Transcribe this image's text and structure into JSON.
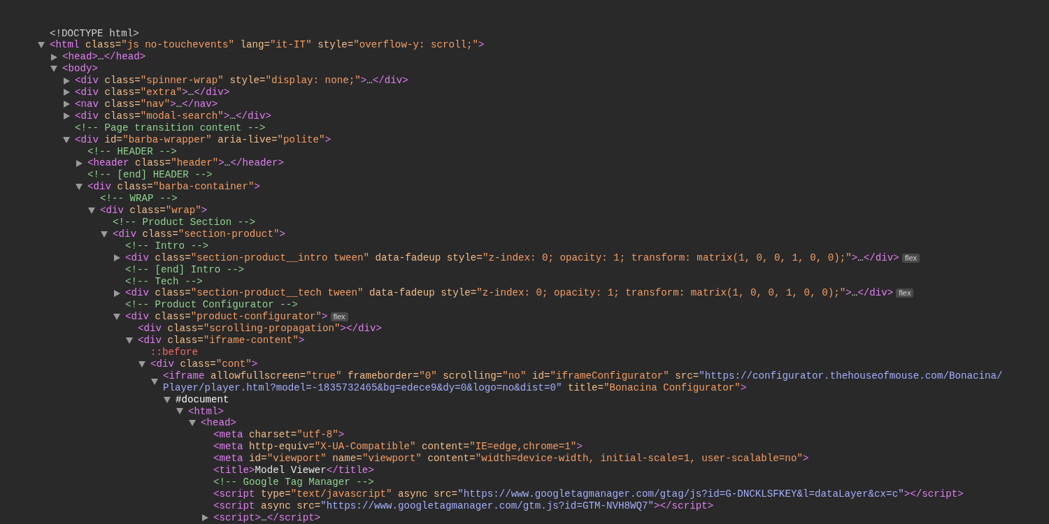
{
  "nodes": [
    {
      "segments": [
        {
          "kind": "doctype",
          "text": "<!DOCTYPE html>"
        }
      ]
    },
    {
      "expanded": true,
      "segments": [
        {
          "kind": "tag",
          "text": "<html"
        },
        {
          "kind": "attr",
          "text": " class="
        },
        {
          "kind": "value",
          "text": "\"js no-touchevents\""
        },
        {
          "kind": "attr",
          "text": " lang="
        },
        {
          "kind": "value",
          "text": "\"it-IT\""
        },
        {
          "kind": "attr",
          "text": " style="
        },
        {
          "kind": "value",
          "text": "\"overflow-y: scroll;\""
        },
        {
          "kind": "tag",
          "text": ">"
        }
      ],
      "children": [
        {
          "expanded": false,
          "segments": [
            {
              "kind": "tag",
              "text": "<head>"
            },
            {
              "kind": "text",
              "text": "…"
            },
            {
              "kind": "tag",
              "text": "</head>"
            }
          ]
        },
        {
          "expanded": true,
          "segments": [
            {
              "kind": "tag",
              "text": "<body>"
            }
          ],
          "children": [
            {
              "expanded": false,
              "segments": [
                {
                  "kind": "tag",
                  "text": "<div"
                },
                {
                  "kind": "attr",
                  "text": " class="
                },
                {
                  "kind": "value",
                  "text": "\"spinner-wrap\""
                },
                {
                  "kind": "attr",
                  "text": " style="
                },
                {
                  "kind": "value",
                  "text": "\"display: none;\""
                },
                {
                  "kind": "tag",
                  "text": ">"
                },
                {
                  "kind": "text",
                  "text": "…"
                },
                {
                  "kind": "tag",
                  "text": "</div>"
                }
              ]
            },
            {
              "expanded": false,
              "segments": [
                {
                  "kind": "tag",
                  "text": "<div"
                },
                {
                  "kind": "attr",
                  "text": " class="
                },
                {
                  "kind": "value",
                  "text": "\"extra\""
                },
                {
                  "kind": "tag",
                  "text": ">"
                },
                {
                  "kind": "text",
                  "text": "…"
                },
                {
                  "kind": "tag",
                  "text": "</div>"
                }
              ]
            },
            {
              "expanded": false,
              "segments": [
                {
                  "kind": "tag",
                  "text": "<nav"
                },
                {
                  "kind": "attr",
                  "text": " class="
                },
                {
                  "kind": "value",
                  "text": "\"nav\""
                },
                {
                  "kind": "tag",
                  "text": ">"
                },
                {
                  "kind": "text",
                  "text": "…"
                },
                {
                  "kind": "tag",
                  "text": "</nav>"
                }
              ]
            },
            {
              "expanded": false,
              "segments": [
                {
                  "kind": "tag",
                  "text": "<div"
                },
                {
                  "kind": "attr",
                  "text": " class="
                },
                {
                  "kind": "value",
                  "text": "\"modal-search\""
                },
                {
                  "kind": "tag",
                  "text": ">"
                },
                {
                  "kind": "text",
                  "text": "…"
                },
                {
                  "kind": "tag",
                  "text": "</div>"
                }
              ]
            },
            {
              "segments": [
                {
                  "kind": "comment",
                  "text": "<!-- Page transition content -->"
                }
              ]
            },
            {
              "expanded": true,
              "segments": [
                {
                  "kind": "tag",
                  "text": "<div"
                },
                {
                  "kind": "attr",
                  "text": " id="
                },
                {
                  "kind": "value",
                  "text": "\"barba-wrapper\""
                },
                {
                  "kind": "attr",
                  "text": " aria-live="
                },
                {
                  "kind": "value",
                  "text": "\"polite\""
                },
                {
                  "kind": "tag",
                  "text": ">"
                }
              ],
              "children": [
                {
                  "segments": [
                    {
                      "kind": "comment",
                      "text": "<!-- HEADER -->"
                    }
                  ]
                },
                {
                  "expanded": false,
                  "segments": [
                    {
                      "kind": "tag",
                      "text": "<header"
                    },
                    {
                      "kind": "attr",
                      "text": " class="
                    },
                    {
                      "kind": "value",
                      "text": "\"header\""
                    },
                    {
                      "kind": "tag",
                      "text": ">"
                    },
                    {
                      "kind": "text",
                      "text": "…"
                    },
                    {
                      "kind": "tag",
                      "text": "</header>"
                    }
                  ]
                },
                {
                  "segments": [
                    {
                      "kind": "comment",
                      "text": "<!-- [end] HEADER -->"
                    }
                  ]
                },
                {
                  "expanded": true,
                  "segments": [
                    {
                      "kind": "tag",
                      "text": "<div"
                    },
                    {
                      "kind": "attr",
                      "text": " class="
                    },
                    {
                      "kind": "value",
                      "text": "\"barba-container\""
                    },
                    {
                      "kind": "tag",
                      "text": ">"
                    }
                  ],
                  "children": [
                    {
                      "segments": [
                        {
                          "kind": "comment",
                          "text": "<!-- WRAP -->"
                        }
                      ]
                    },
                    {
                      "expanded": true,
                      "segments": [
                        {
                          "kind": "tag",
                          "text": "<div"
                        },
                        {
                          "kind": "attr",
                          "text": " class="
                        },
                        {
                          "kind": "value",
                          "text": "\"wrap\""
                        },
                        {
                          "kind": "tag",
                          "text": ">"
                        }
                      ],
                      "children": [
                        {
                          "segments": [
                            {
                              "kind": "comment",
                              "text": "<!-- Product Section -->"
                            }
                          ]
                        },
                        {
                          "expanded": true,
                          "segments": [
                            {
                              "kind": "tag",
                              "text": "<div"
                            },
                            {
                              "kind": "attr",
                              "text": " class="
                            },
                            {
                              "kind": "value",
                              "text": "\"section-product\""
                            },
                            {
                              "kind": "tag",
                              "text": ">"
                            }
                          ],
                          "children": [
                            {
                              "segments": [
                                {
                                  "kind": "comment",
                                  "text": "<!-- Intro -->"
                                }
                              ]
                            },
                            {
                              "expanded": false,
                              "badge": "flex",
                              "segments": [
                                {
                                  "kind": "tag",
                                  "text": "<div"
                                },
                                {
                                  "kind": "attr",
                                  "text": " class="
                                },
                                {
                                  "kind": "value",
                                  "text": "\"section-product__intro tween\""
                                },
                                {
                                  "kind": "attr",
                                  "text": " data-fadeup"
                                },
                                {
                                  "kind": "attr",
                                  "text": " style="
                                },
                                {
                                  "kind": "value",
                                  "text": "\"z-index: 0; opacity: 1; transform: matrix(1, 0, 0, 1, 0, 0);\""
                                },
                                {
                                  "kind": "tag",
                                  "text": ">"
                                },
                                {
                                  "kind": "text",
                                  "text": "…"
                                },
                                {
                                  "kind": "tag",
                                  "text": "</div>"
                                }
                              ]
                            },
                            {
                              "segments": [
                                {
                                  "kind": "comment",
                                  "text": "<!-- [end] Intro -->"
                                }
                              ]
                            },
                            {
                              "segments": [
                                {
                                  "kind": "comment",
                                  "text": "<!-- Tech -->"
                                }
                              ]
                            },
                            {
                              "expanded": false,
                              "badge": "flex",
                              "segments": [
                                {
                                  "kind": "tag",
                                  "text": "<div"
                                },
                                {
                                  "kind": "attr",
                                  "text": " class="
                                },
                                {
                                  "kind": "value",
                                  "text": "\"section-product__tech tween\""
                                },
                                {
                                  "kind": "attr",
                                  "text": " data-fadeup"
                                },
                                {
                                  "kind": "attr",
                                  "text": " style="
                                },
                                {
                                  "kind": "value",
                                  "text": "\"z-index: 0; opacity: 1; transform: matrix(1, 0, 0, 1, 0, 0);\""
                                },
                                {
                                  "kind": "tag",
                                  "text": ">"
                                },
                                {
                                  "kind": "text",
                                  "text": "…"
                                },
                                {
                                  "kind": "tag",
                                  "text": "</div>"
                                }
                              ]
                            },
                            {
                              "segments": [
                                {
                                  "kind": "comment",
                                  "text": "<!-- Product Configurator -->"
                                }
                              ]
                            },
                            {
                              "expanded": true,
                              "badge": "flex",
                              "segments": [
                                {
                                  "kind": "tag",
                                  "text": "<div"
                                },
                                {
                                  "kind": "attr",
                                  "text": " class="
                                },
                                {
                                  "kind": "value",
                                  "text": "\"product-configurator\""
                                },
                                {
                                  "kind": "tag",
                                  "text": ">"
                                }
                              ],
                              "children": [
                                {
                                  "segments": [
                                    {
                                      "kind": "tag",
                                      "text": "<div"
                                    },
                                    {
                                      "kind": "attr",
                                      "text": " class="
                                    },
                                    {
                                      "kind": "value",
                                      "text": "\"scrolling-propagation\""
                                    },
                                    {
                                      "kind": "tag",
                                      "text": "></div>"
                                    }
                                  ]
                                },
                                {
                                  "expanded": true,
                                  "segments": [
                                    {
                                      "kind": "tag",
                                      "text": "<div"
                                    },
                                    {
                                      "kind": "attr",
                                      "text": " class="
                                    },
                                    {
                                      "kind": "value",
                                      "text": "\"iframe-content\""
                                    },
                                    {
                                      "kind": "tag",
                                      "text": ">"
                                    }
                                  ],
                                  "children": [
                                    {
                                      "segments": [
                                        {
                                          "kind": "pseudo",
                                          "text": "::before"
                                        }
                                      ]
                                    },
                                    {
                                      "expanded": true,
                                      "segments": [
                                        {
                                          "kind": "tag",
                                          "text": "<div"
                                        },
                                        {
                                          "kind": "attr",
                                          "text": " class="
                                        },
                                        {
                                          "kind": "value",
                                          "text": "\"cont\""
                                        },
                                        {
                                          "kind": "tag",
                                          "text": ">"
                                        }
                                      ],
                                      "children": [
                                        {
                                          "expanded": true,
                                          "segments": [
                                            {
                                              "kind": "tag",
                                              "text": "<iframe"
                                            },
                                            {
                                              "kind": "attr",
                                              "text": " allowfullscreen="
                                            },
                                            {
                                              "kind": "value",
                                              "text": "\"true\""
                                            },
                                            {
                                              "kind": "attr",
                                              "text": " frameborder="
                                            },
                                            {
                                              "kind": "value",
                                              "text": "\"0\""
                                            },
                                            {
                                              "kind": "attr",
                                              "text": " scrolling="
                                            },
                                            {
                                              "kind": "value",
                                              "text": "\"no\""
                                            },
                                            {
                                              "kind": "attr",
                                              "text": " id="
                                            },
                                            {
                                              "kind": "value",
                                              "text": "\"iframeConfigurator\""
                                            },
                                            {
                                              "kind": "attr",
                                              "text": " src="
                                            },
                                            {
                                              "kind": "link",
                                              "text": "\"https://configurator.thehouseofmouse.com/Bonacina/"
                                            },
                                            {
                                              "kind": "link",
                                              "text": "Player/player.html?model=-1835732465&bg=edece9&dy=0&logo=no&dist=0\""
                                            },
                                            {
                                              "kind": "attr",
                                              "text": " title="
                                            },
                                            {
                                              "kind": "value",
                                              "text": "\"Bonacina Configurator\""
                                            },
                                            {
                                              "kind": "tag",
                                              "text": ">"
                                            }
                                          ],
                                          "children": [
                                            {
                                              "expanded": true,
                                              "segments": [
                                                {
                                                  "kind": "document",
                                                  "text": "#document"
                                                }
                                              ],
                                              "children": [
                                                {
                                                  "expanded": true,
                                                  "segments": [
                                                    {
                                                      "kind": "tag",
                                                      "text": "<html>"
                                                    }
                                                  ],
                                                  "children": [
                                                    {
                                                      "expanded": true,
                                                      "segments": [
                                                        {
                                                          "kind": "tag",
                                                          "text": "<head>"
                                                        }
                                                      ],
                                                      "children": [
                                                        {
                                                          "segments": [
                                                            {
                                                              "kind": "tag",
                                                              "text": "<meta"
                                                            },
                                                            {
                                                              "kind": "attr",
                                                              "text": " charset="
                                                            },
                                                            {
                                                              "kind": "value",
                                                              "text": "\"utf-8\""
                                                            },
                                                            {
                                                              "kind": "tag",
                                                              "text": ">"
                                                            }
                                                          ]
                                                        },
                                                        {
                                                          "segments": [
                                                            {
                                                              "kind": "tag",
                                                              "text": "<meta"
                                                            },
                                                            {
                                                              "kind": "attr",
                                                              "text": " http-equiv="
                                                            },
                                                            {
                                                              "kind": "value",
                                                              "text": "\"X-UA-Compatible\""
                                                            },
                                                            {
                                                              "kind": "attr",
                                                              "text": " content="
                                                            },
                                                            {
                                                              "kind": "value",
                                                              "text": "\"IE=edge,chrome=1\""
                                                            },
                                                            {
                                                              "kind": "tag",
                                                              "text": ">"
                                                            }
                                                          ]
                                                        },
                                                        {
                                                          "segments": [
                                                            {
                                                              "kind": "tag",
                                                              "text": "<meta"
                                                            },
                                                            {
                                                              "kind": "attr",
                                                              "text": " id="
                                                            },
                                                            {
                                                              "kind": "value",
                                                              "text": "\"viewport\""
                                                            },
                                                            {
                                                              "kind": "attr",
                                                              "text": " name="
                                                            },
                                                            {
                                                              "kind": "value",
                                                              "text": "\"viewport\""
                                                            },
                                                            {
                                                              "kind": "attr",
                                                              "text": " content="
                                                            },
                                                            {
                                                              "kind": "value",
                                                              "text": "\"width=device-width, initial-scale=1, user-scalable=no\""
                                                            },
                                                            {
                                                              "kind": "tag",
                                                              "text": ">"
                                                            }
                                                          ]
                                                        },
                                                        {
                                                          "segments": [
                                                            {
                                                              "kind": "tag",
                                                              "text": "<title>"
                                                            },
                                                            {
                                                              "kind": "text",
                                                              "text": "Model Viewer"
                                                            },
                                                            {
                                                              "kind": "tag",
                                                              "text": "</title>"
                                                            }
                                                          ]
                                                        },
                                                        {
                                                          "segments": [
                                                            {
                                                              "kind": "comment",
                                                              "text": "<!-- Google Tag Manager -->"
                                                            }
                                                          ]
                                                        },
                                                        {
                                                          "segments": [
                                                            {
                                                              "kind": "tag",
                                                              "text": "<script"
                                                            },
                                                            {
                                                              "kind": "attr",
                                                              "text": " type="
                                                            },
                                                            {
                                                              "kind": "value",
                                                              "text": "\"text/javascript\""
                                                            },
                                                            {
                                                              "kind": "attr",
                                                              "text": " async"
                                                            },
                                                            {
                                                              "kind": "attr",
                                                              "text": " src="
                                                            },
                                                            {
                                                              "kind": "link",
                                                              "text": "\"https://www.googletagmanager.com/gtag/js?id=G-DNCKLSFKEY&l=dataLayer&cx=c\""
                                                            },
                                                            {
                                                              "kind": "tag",
                                                              "text": "></script>"
                                                            }
                                                          ]
                                                        },
                                                        {
                                                          "segments": [
                                                            {
                                                              "kind": "tag",
                                                              "text": "<script"
                                                            },
                                                            {
                                                              "kind": "attr",
                                                              "text": " async"
                                                            },
                                                            {
                                                              "kind": "attr",
                                                              "text": " src="
                                                            },
                                                            {
                                                              "kind": "link",
                                                              "text": "\"https://www.googletagmanager.com/gtm.js?id=GTM-NVH8WQ7\""
                                                            },
                                                            {
                                                              "kind": "tag",
                                                              "text": "></script>"
                                                            }
                                                          ]
                                                        },
                                                        {
                                                          "expanded": false,
                                                          "segments": [
                                                            {
                                                              "kind": "tag",
                                                              "text": "<script>"
                                                            },
                                                            {
                                                              "kind": "text",
                                                              "text": "…"
                                                            },
                                                            {
                                                              "kind": "tag",
                                                              "text": "</script>"
                                                            }
                                                          ]
                                                        }
                                                      ]
                                                    }
                                                  ]
                                                }
                                              ]
                                            }
                                          ]
                                        }
                                      ]
                                    }
                                  ]
                                }
                              ]
                            }
                          ]
                        }
                      ]
                    }
                  ]
                }
              ]
            }
          ]
        }
      ]
    }
  ]
}
